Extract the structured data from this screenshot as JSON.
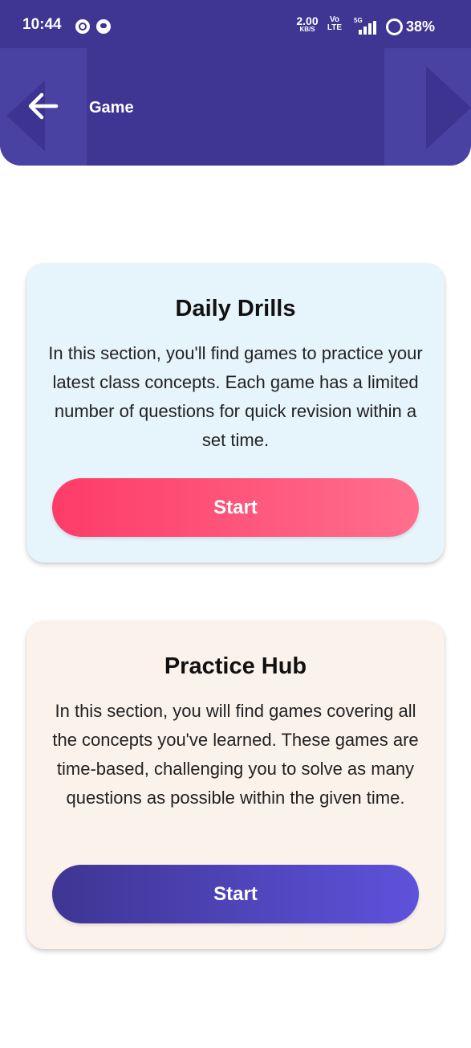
{
  "status_bar": {
    "time": "10:44",
    "network_speed_value": "2.00",
    "network_speed_unit": "KB/S",
    "volte_top": "Vo",
    "volte_bottom": "LTE",
    "network_type": "5G",
    "battery": "38%"
  },
  "header": {
    "title": "Game",
    "back_icon": "arrow-left-icon",
    "background_color": "#3f3593"
  },
  "cards": [
    {
      "title": "Daily Drills",
      "description": "In this section, you'll find games to practice your latest class concepts. Each game has a limited number of questions for quick revision within a set time.",
      "button_label": "Start",
      "background_color": "#e6f4fb",
      "button_color": "#fd3c68"
    },
    {
      "title": "Practice Hub",
      "description": "In this section, you will find games covering all the concepts you've learned. These games are time-based, challenging you to solve as many questions as possible within the given time.",
      "button_label": "Start",
      "background_color": "#fcf2ec",
      "button_color": "#4a40b8"
    }
  ]
}
